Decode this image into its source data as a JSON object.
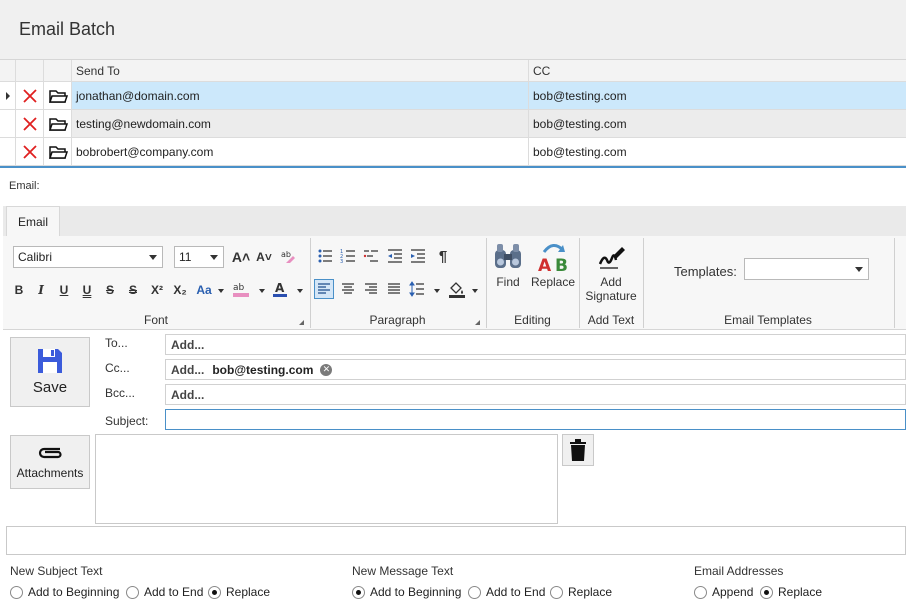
{
  "window": {
    "title": "Email Batch"
  },
  "grid": {
    "columns": {
      "send_to": "Send To",
      "cc": "CC"
    },
    "rows": [
      {
        "send_to": "jonathan@domain.com",
        "cc": "bob@testing.com"
      },
      {
        "send_to": "testing@newdomain.com",
        "cc": "bob@testing.com"
      },
      {
        "send_to": "bobrobert@company.com",
        "cc": "bob@testing.com"
      }
    ]
  },
  "email_panel": {
    "label": "Email:",
    "tab": "Email",
    "ribbon": {
      "font": {
        "family": "Calibri",
        "size": "11",
        "group_label": "Font"
      },
      "paragraph": {
        "group_label": "Paragraph"
      },
      "editing": {
        "find": "Find",
        "replace": "Replace",
        "group_label": "Editing"
      },
      "add_text": {
        "add_signature_line1": "Add",
        "add_signature_line2": "Signature",
        "group_label": "Add Text"
      },
      "templates": {
        "label": "Templates:",
        "value": "",
        "group_label": "Email Templates"
      }
    },
    "form": {
      "save_label": "Save",
      "attachments_label": "Attachments",
      "to_label": "To...",
      "cc_label": "Cc...",
      "bcc_label": "Bcc...",
      "subject_label": "Subject:",
      "add_placeholder": "Add...",
      "cc_chip": "bob@testing.com",
      "subject_value": ""
    },
    "options": {
      "subject": {
        "title": "New Subject Text",
        "choices": [
          "Add to Beginning",
          "Add to End",
          "Replace"
        ],
        "selected": "Replace"
      },
      "message": {
        "title": "New Message Text",
        "choices": [
          "Add to Beginning",
          "Add to End",
          "Replace"
        ],
        "selected": "Add to Beginning"
      },
      "addresses": {
        "title": "Email Addresses",
        "choices": [
          "Append",
          "Replace"
        ],
        "selected": "Replace"
      }
    }
  },
  "colors": {
    "accent": "#4a90c8",
    "selected_row": "#cce8fb",
    "delete_red": "#e02020",
    "save_icon": "#3b5bdb"
  }
}
